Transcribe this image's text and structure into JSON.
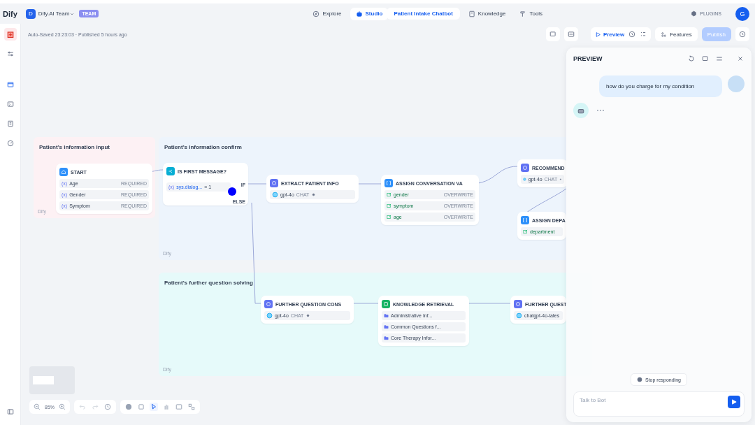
{
  "brand": {
    "logo": "Dify"
  },
  "team": {
    "initial": "D",
    "name": "Dify.AI Team",
    "badge": "TEAM"
  },
  "nav": [
    {
      "label": "Explore",
      "selected": false
    },
    {
      "label": "Studio",
      "selected": true
    },
    {
      "label": "Knowledge",
      "selected": false
    },
    {
      "label": "Tools",
      "selected": false
    }
  ],
  "breadcrumb": "Patient Intake Chatbot",
  "plugins": "PLUGINS",
  "avatar": "G",
  "status": "Auto-Saved 23:23:03 · Published 5 hours ago",
  "toolbar": {
    "preview": "Preview",
    "features": "Features",
    "publish": "Publish"
  },
  "groups": [
    {
      "title": "Patient's information input",
      "footer": "Dify",
      "color": "#fdf1f4"
    },
    {
      "title": "Patient's information confirm",
      "footer": "Dify",
      "color": "#edf4fc"
    },
    {
      "title": "Patient's further question solving",
      "footer": "Dify",
      "color": "#e6fafa"
    }
  ],
  "nodes": [
    {
      "kind": "start",
      "title": "START",
      "rows": [
        {
          "prefix": "(x)",
          "label": "Age",
          "tag": "REQUIRED"
        },
        {
          "prefix": "(x)",
          "label": "Gender",
          "tag": "REQUIRED"
        },
        {
          "prefix": "(x)",
          "label": "Symptom",
          "tag": "REQUIRED"
        }
      ]
    },
    {
      "kind": "if",
      "title": "IS FIRST MESSAGE?",
      "prefix": "(x)",
      "variable": "sys.dialog...",
      "operator": "= 1",
      "branches": [
        "IF",
        "ELSE"
      ]
    },
    {
      "kind": "llm",
      "title": "EXTRACT PATIENT INFO",
      "model": "gpt-4o",
      "tag": "CHAT"
    },
    {
      "kind": "assign",
      "title": "ASSIGN CONVERSATION VA",
      "rows": [
        {
          "name": "gender",
          "mode": "OVERWRITE"
        },
        {
          "name": "symptom",
          "mode": "OVERWRITE"
        },
        {
          "name": "age",
          "mode": "OVERWRITE"
        }
      ]
    },
    {
      "kind": "llm",
      "title": "RECOMMEND",
      "model": "gpt-4o",
      "tag": "CHAT"
    },
    {
      "kind": "assign",
      "title": "ASSIGN DEPA",
      "rows": [
        {
          "name": "department"
        }
      ]
    },
    {
      "kind": "llm",
      "title": "FURTHER QUESTION CONS",
      "model": "gpt-4o",
      "tag": "CHAT"
    },
    {
      "kind": "knowledge",
      "title": "KNOWLEDGE RETRIEVAL",
      "datasets": [
        "Administrative Inf...",
        "Common Questions f...",
        "Core Therapy Infor..."
      ]
    },
    {
      "kind": "llm",
      "title": "FURTHER QUEST",
      "model": "chatgpt-4o-lates"
    }
  ],
  "preview": {
    "title": "PREVIEW",
    "messages": [
      {
        "kind": "text",
        "text": "how do you charge for my condition"
      },
      {
        "kind": "typing"
      }
    ],
    "stop": "Stop responding",
    "placeholder": "Talk to Bot"
  },
  "zoom": "85%"
}
